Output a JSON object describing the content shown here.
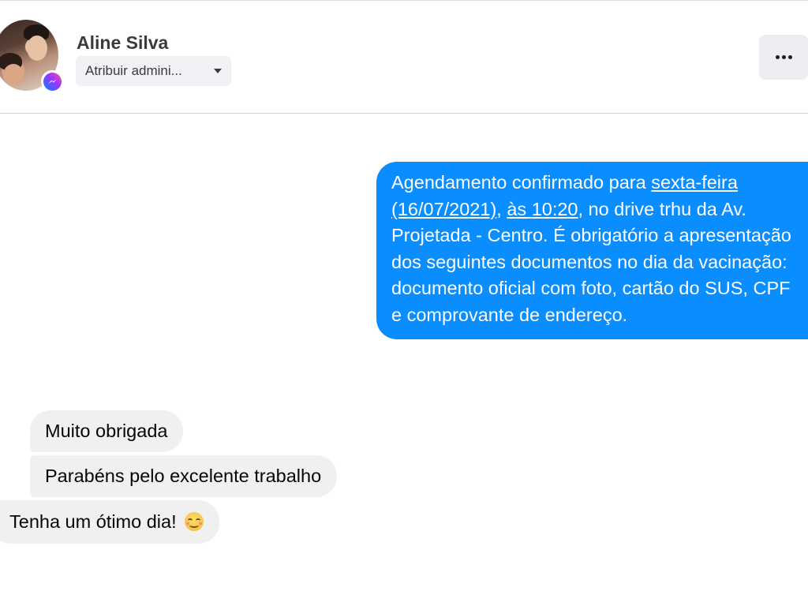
{
  "header": {
    "contact_name": "Aline Silva",
    "assign_select": {
      "selected_label": "Atribuir admini..."
    },
    "more_options_icon": "more-horizontal-icon",
    "badge_icon": "messenger-icon"
  },
  "conversation": {
    "outgoing": [
      {
        "part1": "Agendamento confirmado para ",
        "link_day": "sexta-feira",
        "part2": " ",
        "link_date": "(16/07/2021)",
        "part3": ", ",
        "link_time": "às 10:20",
        "part4": ", no drive trhu da Av. Projetada - Centro. É obrigatório a apresentação dos seguintes documentos no dia da vacinação: documento oficial com foto, cartão do SUS, CPF e comprovante de endereço."
      }
    ],
    "incoming": [
      {
        "text": "Muito obrigada"
      },
      {
        "text": "Parabéns pelo excelente trabalho"
      },
      {
        "text": "Tenha um ótimo dia!",
        "emoji": "smiling-face-icon"
      }
    ]
  },
  "colors": {
    "outgoing_bubble": "#0a8eff",
    "incoming_bubble": "#f0f0f0",
    "header_divider": "#d0d0d0"
  }
}
